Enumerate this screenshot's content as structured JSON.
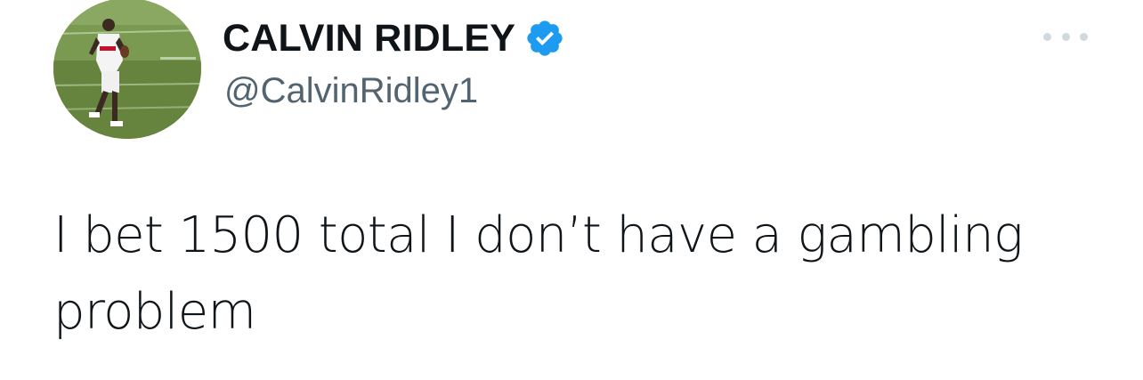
{
  "tweet": {
    "author": {
      "display_name": "CALVIN RIDLEY",
      "handle": "@CalvinRidley1",
      "verified": true,
      "verified_icon": "verified-badge-icon",
      "avatar_icon": "profile-photo"
    },
    "text": "I bet 1500 total I don’t have a gambling problem",
    "more_icon": "more-options-icon"
  },
  "colors": {
    "text_primary": "#0f1419",
    "text_secondary": "#536471",
    "verified_blue": "#1d9bf0",
    "more_dots": "#cfd9de",
    "background": "#ffffff"
  }
}
